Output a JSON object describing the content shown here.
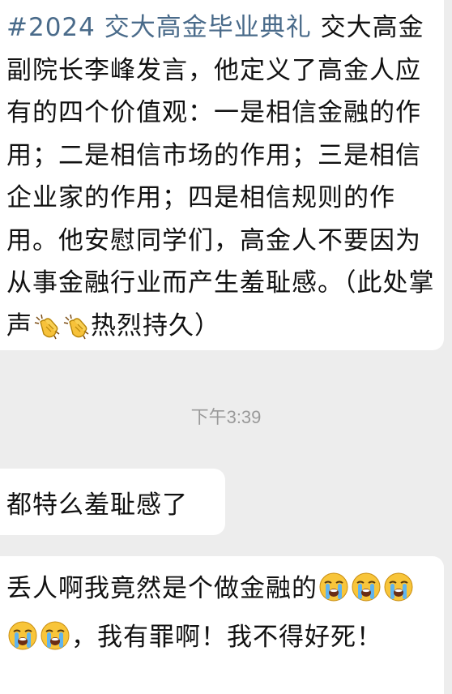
{
  "messages": [
    {
      "hashtag": "#2024 交大高金毕业典礼",
      "text_1": " 交大高金副院长李峰发言，他定义了高金人应有的四个价值观：一是相信金融的作用；二是相信市场的作用；三是相信企业家的作用；四是相信规则的作用。他安慰同学们，高金人不要因为从事金融行业而产生羞耻感。（此处掌声",
      "emoji_1": "clapping-hands",
      "emoji_2": "clapping-hands",
      "text_2": "热烈持久）"
    },
    {
      "text": "都特么羞耻感了"
    },
    {
      "text_1": "丢人啊我竟然是个做金融的",
      "emojis": [
        "loudly-crying-face",
        "loudly-crying-face",
        "loudly-crying-face",
        "loudly-crying-face",
        "loudly-crying-face"
      ],
      "text_2": "，我有罪啊！我不得好死！"
    }
  ],
  "timestamp": "下午3:39",
  "colors": {
    "background": "#ededed",
    "bubble": "#ffffff",
    "hashtag": "#4a6b8a",
    "timestamp": "#9a9a9a"
  }
}
